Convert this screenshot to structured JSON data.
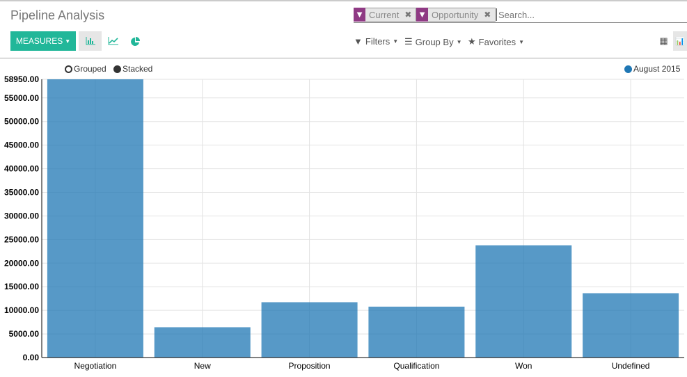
{
  "header": {
    "title": "Pipeline Analysis"
  },
  "toolbar": {
    "measures_label": "MEASURES",
    "view_buttons": [
      "bar-chart-icon",
      "line-chart-icon",
      "pie-chart-icon"
    ],
    "accent": "#21b799"
  },
  "search": {
    "facets": [
      {
        "label": "Current",
        "icon": "filter-icon"
      },
      {
        "label": "Opportunity",
        "icon": "filter-icon"
      }
    ],
    "placeholder": "Search...",
    "facet_color": "#8f3a84"
  },
  "search_options": {
    "filters": "Filters",
    "group_by": "Group By",
    "favorites": "Favorites"
  },
  "view_switcher": [
    "pivot-grid-icon",
    "graph-icon"
  ],
  "chart_controls": {
    "grouped": "Grouped",
    "stacked": "Stacked"
  },
  "chart_data": {
    "type": "bar",
    "categories": [
      "Negotiation",
      "New",
      "Proposition",
      "Qualification",
      "Won",
      "Undefined"
    ],
    "series": [
      {
        "name": "August 2015",
        "color": "#1f77b4",
        "values": [
          58950,
          6420,
          11720,
          10780,
          23780,
          13630
        ]
      }
    ],
    "ylim": [
      0,
      58950
    ],
    "yticks": [
      "0.00",
      "5000.00",
      "10000.00",
      "15000.00",
      "20000.00",
      "25000.00",
      "30000.00",
      "35000.00",
      "40000.00",
      "45000.00",
      "50000.00",
      "55000.00",
      "58950.00"
    ],
    "grid": true,
    "legend": "top-right"
  }
}
